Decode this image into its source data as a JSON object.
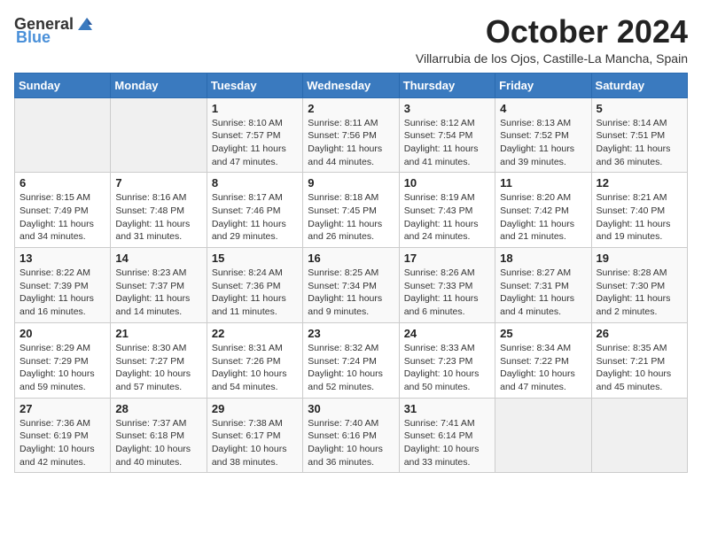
{
  "header": {
    "logo_general": "General",
    "logo_blue": "Blue",
    "title": "October 2024",
    "subtitle": "Villarrubia de los Ojos, Castille-La Mancha, Spain"
  },
  "days_of_week": [
    "Sunday",
    "Monday",
    "Tuesday",
    "Wednesday",
    "Thursday",
    "Friday",
    "Saturday"
  ],
  "weeks": [
    [
      {
        "day": "",
        "info": ""
      },
      {
        "day": "",
        "info": ""
      },
      {
        "day": "1",
        "info": "Sunrise: 8:10 AM\nSunset: 7:57 PM\nDaylight: 11 hours and 47 minutes."
      },
      {
        "day": "2",
        "info": "Sunrise: 8:11 AM\nSunset: 7:56 PM\nDaylight: 11 hours and 44 minutes."
      },
      {
        "day": "3",
        "info": "Sunrise: 8:12 AM\nSunset: 7:54 PM\nDaylight: 11 hours and 41 minutes."
      },
      {
        "day": "4",
        "info": "Sunrise: 8:13 AM\nSunset: 7:52 PM\nDaylight: 11 hours and 39 minutes."
      },
      {
        "day": "5",
        "info": "Sunrise: 8:14 AM\nSunset: 7:51 PM\nDaylight: 11 hours and 36 minutes."
      }
    ],
    [
      {
        "day": "6",
        "info": "Sunrise: 8:15 AM\nSunset: 7:49 PM\nDaylight: 11 hours and 34 minutes."
      },
      {
        "day": "7",
        "info": "Sunrise: 8:16 AM\nSunset: 7:48 PM\nDaylight: 11 hours and 31 minutes."
      },
      {
        "day": "8",
        "info": "Sunrise: 8:17 AM\nSunset: 7:46 PM\nDaylight: 11 hours and 29 minutes."
      },
      {
        "day": "9",
        "info": "Sunrise: 8:18 AM\nSunset: 7:45 PM\nDaylight: 11 hours and 26 minutes."
      },
      {
        "day": "10",
        "info": "Sunrise: 8:19 AM\nSunset: 7:43 PM\nDaylight: 11 hours and 24 minutes."
      },
      {
        "day": "11",
        "info": "Sunrise: 8:20 AM\nSunset: 7:42 PM\nDaylight: 11 hours and 21 minutes."
      },
      {
        "day": "12",
        "info": "Sunrise: 8:21 AM\nSunset: 7:40 PM\nDaylight: 11 hours and 19 minutes."
      }
    ],
    [
      {
        "day": "13",
        "info": "Sunrise: 8:22 AM\nSunset: 7:39 PM\nDaylight: 11 hours and 16 minutes."
      },
      {
        "day": "14",
        "info": "Sunrise: 8:23 AM\nSunset: 7:37 PM\nDaylight: 11 hours and 14 minutes."
      },
      {
        "day": "15",
        "info": "Sunrise: 8:24 AM\nSunset: 7:36 PM\nDaylight: 11 hours and 11 minutes."
      },
      {
        "day": "16",
        "info": "Sunrise: 8:25 AM\nSunset: 7:34 PM\nDaylight: 11 hours and 9 minutes."
      },
      {
        "day": "17",
        "info": "Sunrise: 8:26 AM\nSunset: 7:33 PM\nDaylight: 11 hours and 6 minutes."
      },
      {
        "day": "18",
        "info": "Sunrise: 8:27 AM\nSunset: 7:31 PM\nDaylight: 11 hours and 4 minutes."
      },
      {
        "day": "19",
        "info": "Sunrise: 8:28 AM\nSunset: 7:30 PM\nDaylight: 11 hours and 2 minutes."
      }
    ],
    [
      {
        "day": "20",
        "info": "Sunrise: 8:29 AM\nSunset: 7:29 PM\nDaylight: 10 hours and 59 minutes."
      },
      {
        "day": "21",
        "info": "Sunrise: 8:30 AM\nSunset: 7:27 PM\nDaylight: 10 hours and 57 minutes."
      },
      {
        "day": "22",
        "info": "Sunrise: 8:31 AM\nSunset: 7:26 PM\nDaylight: 10 hours and 54 minutes."
      },
      {
        "day": "23",
        "info": "Sunrise: 8:32 AM\nSunset: 7:24 PM\nDaylight: 10 hours and 52 minutes."
      },
      {
        "day": "24",
        "info": "Sunrise: 8:33 AM\nSunset: 7:23 PM\nDaylight: 10 hours and 50 minutes."
      },
      {
        "day": "25",
        "info": "Sunrise: 8:34 AM\nSunset: 7:22 PM\nDaylight: 10 hours and 47 minutes."
      },
      {
        "day": "26",
        "info": "Sunrise: 8:35 AM\nSunset: 7:21 PM\nDaylight: 10 hours and 45 minutes."
      }
    ],
    [
      {
        "day": "27",
        "info": "Sunrise: 7:36 AM\nSunset: 6:19 PM\nDaylight: 10 hours and 42 minutes."
      },
      {
        "day": "28",
        "info": "Sunrise: 7:37 AM\nSunset: 6:18 PM\nDaylight: 10 hours and 40 minutes."
      },
      {
        "day": "29",
        "info": "Sunrise: 7:38 AM\nSunset: 6:17 PM\nDaylight: 10 hours and 38 minutes."
      },
      {
        "day": "30",
        "info": "Sunrise: 7:40 AM\nSunset: 6:16 PM\nDaylight: 10 hours and 36 minutes."
      },
      {
        "day": "31",
        "info": "Sunrise: 7:41 AM\nSunset: 6:14 PM\nDaylight: 10 hours and 33 minutes."
      },
      {
        "day": "",
        "info": ""
      },
      {
        "day": "",
        "info": ""
      }
    ]
  ]
}
